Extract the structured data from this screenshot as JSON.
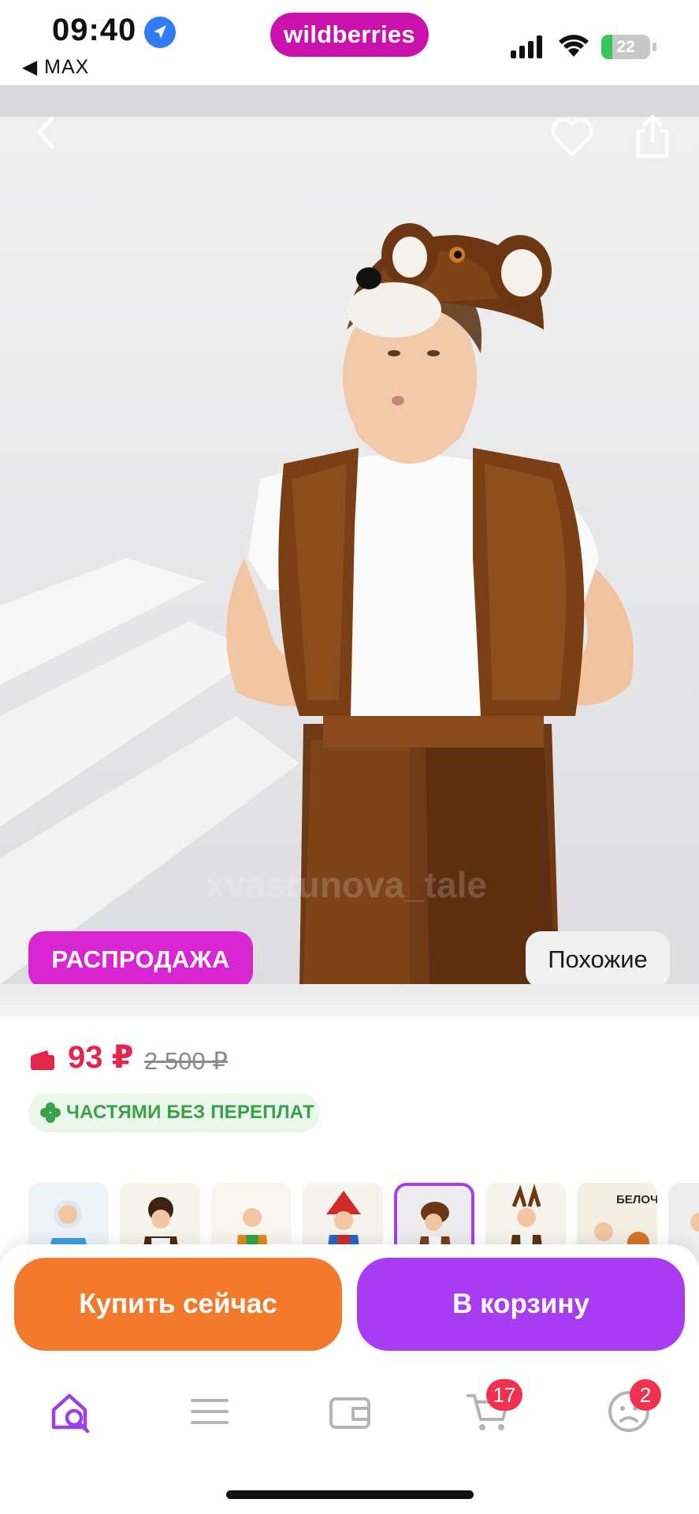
{
  "status_bar": {
    "time": "09:40",
    "back_app": "◀ MAX",
    "battery_level": 22,
    "battery_text": "22"
  },
  "header": {
    "brand": "wildberries"
  },
  "product": {
    "image_watermark": "xvastunova_tale",
    "sale_badge": "РАСПРОДАЖА",
    "similar_button": "Похожие",
    "price": "93 ₽",
    "old_price": "2 500 ₽",
    "installment_label": "ЧАСТЯМИ БЕЗ ПЕРЕПЛАТ",
    "thumbnails": [
      {
        "name": "thumb-1",
        "selected": false,
        "text": ""
      },
      {
        "name": "thumb-2",
        "selected": false,
        "text": ""
      },
      {
        "name": "thumb-3",
        "selected": false,
        "text": ""
      },
      {
        "name": "thumb-4",
        "selected": false,
        "text": ""
      },
      {
        "name": "thumb-5",
        "selected": true,
        "text": ""
      },
      {
        "name": "thumb-6",
        "selected": false,
        "text": ""
      },
      {
        "name": "thumb-7",
        "selected": false,
        "text": "БЕЛОЧКА"
      },
      {
        "name": "thumb-8",
        "selected": false,
        "text": ""
      }
    ]
  },
  "actions": {
    "buy_now": "Купить сейчас",
    "add_to_cart": "В корзину"
  },
  "bottom_nav": {
    "items": [
      {
        "icon": "home-search-icon",
        "active": true
      },
      {
        "icon": "catalog-menu-icon",
        "active": false
      },
      {
        "icon": "wallet-icon",
        "active": false
      },
      {
        "icon": "cart-icon",
        "active": false,
        "badge": "17"
      },
      {
        "icon": "profile-icon",
        "active": false,
        "badge": "2"
      }
    ]
  },
  "colors": {
    "brand": "#cb11ab",
    "sale": "#d926d3",
    "price": "#e3264a",
    "buy_now": "#f27a2a",
    "cart": "#a73cf3",
    "installment": "#3aa14a"
  }
}
